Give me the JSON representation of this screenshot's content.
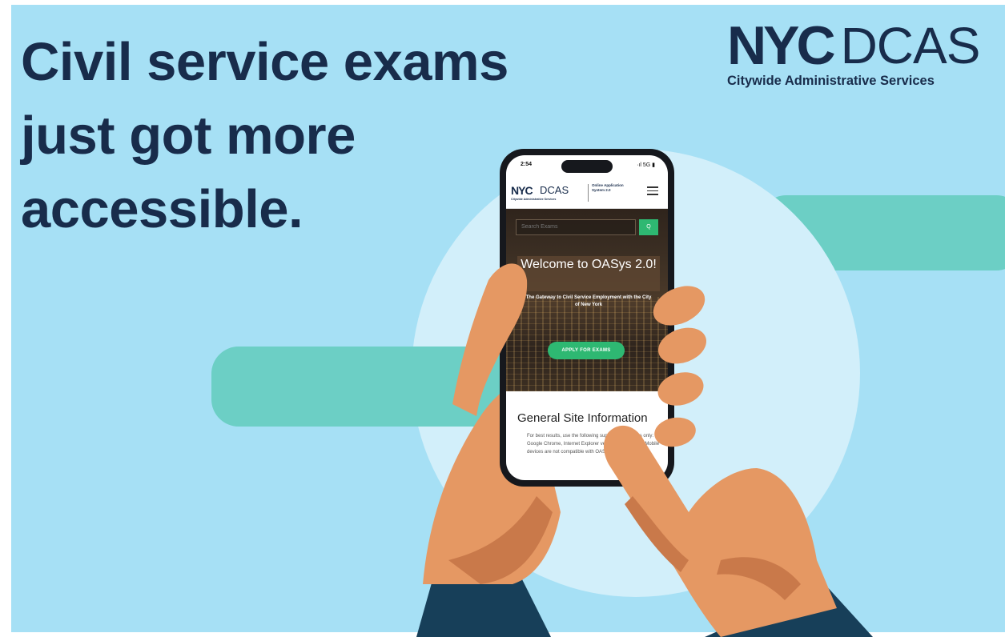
{
  "headline": {
    "line1": "Civil service exams",
    "line2": "just got more",
    "line3": "accessible."
  },
  "logo": {
    "nyc": "NYC",
    "agency": "DCAS",
    "subtitle": "Citywide Administrative Services"
  },
  "phone": {
    "status_time": "2:54",
    "status_right": "·ıl 5G ▮",
    "header": {
      "nyc": "NYC",
      "agency": "DCAS",
      "subtitle": "Citywide Administrative Services",
      "system_name": "Online Application System 2.0"
    },
    "search_placeholder": "Search Exams",
    "search_button": "Q",
    "welcome": "Welcome to OASys 2.0!",
    "tagline": "The Gateway to Civil Service Employment with the City of New York",
    "apply_button": "APPLY FOR EXAMS",
    "info_title": "General Site Information",
    "info_text": "For best results, use the following supported browsers only: Google Chrome, Internet Explorer version 10 and later. Mobile devices are not compatible with OASys 2.0."
  },
  "colors": {
    "background": "#a6e0f5",
    "navy": "#182c4b",
    "teal": "#6ccfc5",
    "green": "#2eb872",
    "skin": "#e59863"
  }
}
